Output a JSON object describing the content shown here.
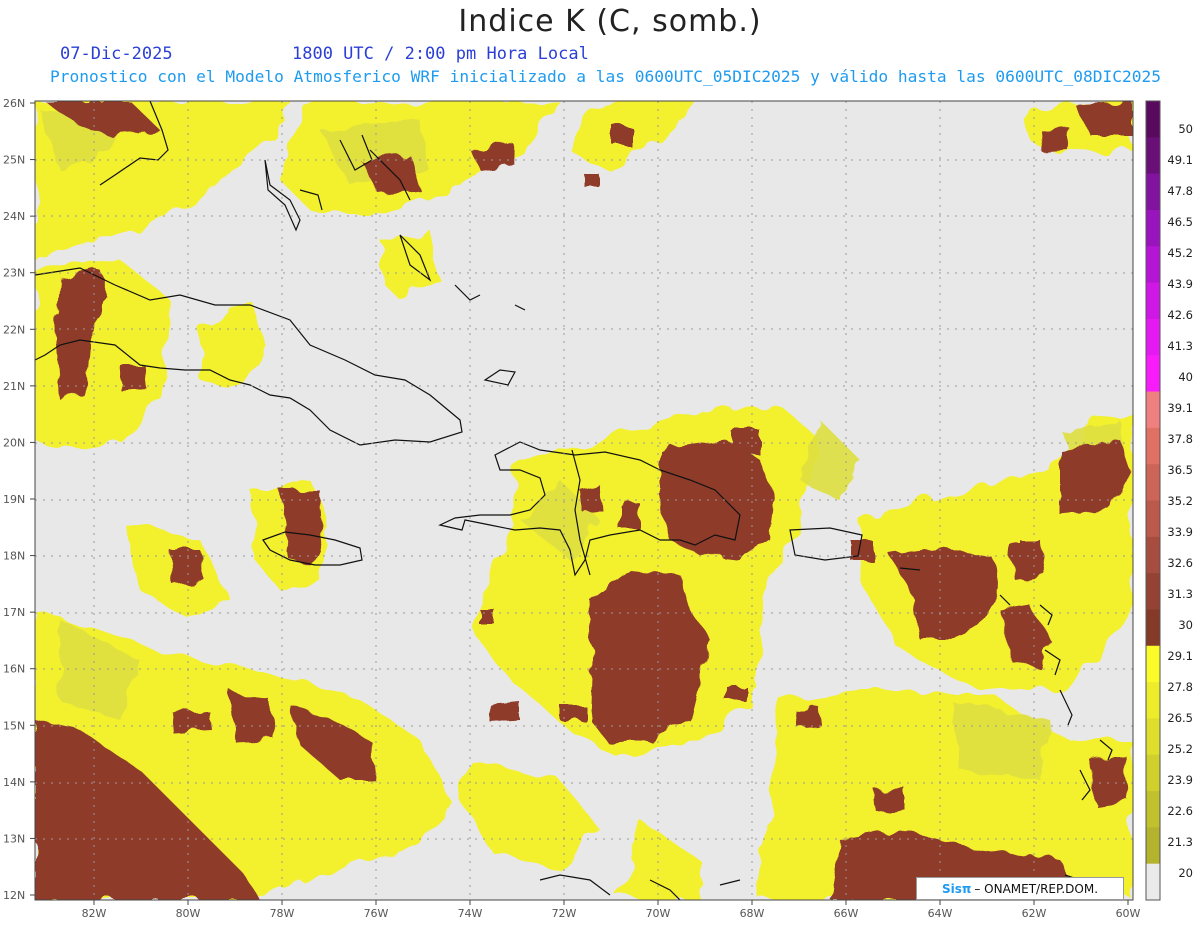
{
  "header": {
    "title": "Indice K (C, somb.)",
    "date": "07-Dic-2025",
    "valid_time": "1800 UTC / 2:00 pm Hora Local",
    "model_line": "Pronostico con el Modelo Atmosferico WRF inicializado a las 0600UTC_05DIC2025 y válido hasta las  0600UTC_08DIC2025"
  },
  "axes": {
    "lat_labels": [
      "26N",
      "25N",
      "24N",
      "23N",
      "22N",
      "21N",
      "20N",
      "19N",
      "18N",
      "17N",
      "16N",
      "15N",
      "14N",
      "13N",
      "12N"
    ],
    "lon_labels": [
      "82W",
      "80W",
      "78W",
      "76W",
      "74W",
      "72W",
      "70W",
      "68W",
      "66W",
      "64W",
      "62W",
      "60W"
    ]
  },
  "colorbar": {
    "labels": [
      "50",
      "49.1",
      "47.8",
      "46.5",
      "45.2",
      "43.9",
      "42.6",
      "41.3",
      "40",
      "39.1",
      "37.8",
      "36.5",
      "35.2",
      "33.9",
      "32.6",
      "31.3",
      "30",
      "29.1",
      "27.8",
      "26.5",
      "25.2",
      "23.9",
      "22.6",
      "21.3",
      "20"
    ],
    "colors": [
      "#5a0a5e",
      "#6a0f78",
      "#8212a0",
      "#9a14bd",
      "#b516d6",
      "#cf18e5",
      "#e51af2",
      "#f81cfb",
      "#f08080",
      "#e06f64",
      "#cd6458",
      "#bb5a4c",
      "#a64d3f",
      "#934233",
      "#853a28",
      "#fbfb2a",
      "#ecec2a",
      "#dede2b",
      "#cfd02c",
      "#c1c12d",
      "#b3b32e",
      "#eaeaea"
    ]
  },
  "map": {
    "background": "#e8e8e8",
    "low_color": "#e8e8e8",
    "yellow": "#f3f02e",
    "khaki": "#dfe03f",
    "brown": "#8e3a2b",
    "coast_color": "#111111",
    "grid_color": "#9a9a9a"
  },
  "credit": {
    "sis": "Sisπ",
    "org": " – ONAMET/REP.DOM."
  }
}
